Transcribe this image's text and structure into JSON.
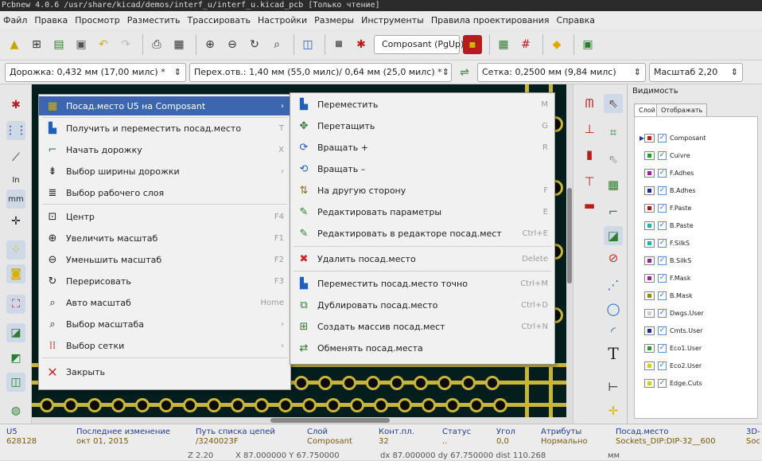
{
  "title_bar": "Pcbnew 4.0.6 /usr/share/kicad/demos/interf_u/interf_u.kicad_pcb [Только чтение]",
  "menubar": [
    "Файл",
    "Правка",
    "Просмотр",
    "Разместить",
    "Трассировать",
    "Настройки",
    "Размеры",
    "Инструменты",
    "Правила проектирования",
    "Справка"
  ],
  "toolbar": {
    "layer_select": "Composant (PgUp)",
    "track_width": "Дорожка: 0,432 мм (17,00 милс) *",
    "via_size": "Перех.отв.: 1,40 мм (55,0 милс)/ 0,64 мм (25,0 милс) *",
    "grid": "Сетка: 0,2500 мм (9,84 милс)",
    "zoom": "Масштаб 2,20"
  },
  "context_menu": {
    "header": "Посад.место U5 на Composant",
    "items": [
      {
        "label": "Получить и переместить посад.место",
        "shortcut": "T"
      },
      {
        "label": "Начать дорожку",
        "shortcut": "X"
      },
      {
        "label": "Выбор ширины дорожки",
        "shortcut": ""
      },
      {
        "label": "Выбор рабочего слоя",
        "shortcut": ""
      },
      {
        "label": "Центр",
        "shortcut": "F4"
      },
      {
        "label": "Увеличить масштаб",
        "shortcut": "F1"
      },
      {
        "label": "Уменьшить масштаб",
        "shortcut": "F2"
      },
      {
        "label": "Перерисовать",
        "shortcut": "F3"
      },
      {
        "label": "Авто масштаб",
        "shortcut": "Home"
      },
      {
        "label": "Выбор масштаба",
        "shortcut": ""
      },
      {
        "label": "Выбор сетки",
        "shortcut": ""
      },
      {
        "label": "Закрыть",
        "shortcut": ""
      }
    ]
  },
  "submenu": {
    "items": [
      {
        "label": "Переместить",
        "shortcut": "M"
      },
      {
        "label": "Перетащить",
        "shortcut": "G"
      },
      {
        "label": "Вращать +",
        "shortcut": "R"
      },
      {
        "label": "Вращать –",
        "shortcut": ""
      },
      {
        "label": "На другую сторону",
        "shortcut": "F"
      },
      {
        "label": "Редактировать параметры",
        "shortcut": "E"
      },
      {
        "label": "Редактировать в редакторе посад.мест",
        "shortcut": "Ctrl+E"
      },
      {
        "label": "Удалить посад.место",
        "shortcut": "Delete"
      },
      {
        "label": "Переместить посад.место точно",
        "shortcut": "Ctrl+M"
      },
      {
        "label": "Дублировать посад.место",
        "shortcut": "Ctrl+D"
      },
      {
        "label": "Создать массив посад.мест",
        "shortcut": "Ctrl+N"
      },
      {
        "label": "Обменять посад.места",
        "shortcut": ""
      }
    ]
  },
  "visibility": {
    "title": "Видимость",
    "tabs": [
      "Слой",
      "Отображать"
    ],
    "layers": [
      {
        "name": "Composant",
        "color": "#c21a1a"
      },
      {
        "name": "Cuivre",
        "color": "#2a9a2a"
      },
      {
        "name": "F.Adhes",
        "color": "#9a209a"
      },
      {
        "name": "B.Adhes",
        "color": "#1a2aa0"
      },
      {
        "name": "F.Paste",
        "color": "#a01a1a"
      },
      {
        "name": "B.Paste",
        "color": "#20b0b0"
      },
      {
        "name": "F.SilkS",
        "color": "#20b0b0"
      },
      {
        "name": "B.SilkS",
        "color": "#9a209a"
      },
      {
        "name": "F.Mask",
        "color": "#9a209a"
      },
      {
        "name": "B.Mask",
        "color": "#8a8a20"
      },
      {
        "name": "Dwgs.User",
        "color": "#cfcfcf"
      },
      {
        "name": "Cmts.User",
        "color": "#1a2aa0"
      },
      {
        "name": "Eco1.User",
        "color": "#2a9a2a"
      },
      {
        "name": "Eco2.User",
        "color": "#d0d020"
      },
      {
        "name": "Edge.Cuts",
        "color": "#d0d020"
      }
    ]
  },
  "status": {
    "ref": "U5",
    "ref_val": "628128",
    "lastmod_h": "Последнее изменение",
    "lastmod_v": "окт 01, 2015",
    "netpath_h": "Путь списка цепей",
    "netpath_v": "/3240023F",
    "layer_h": "Слой",
    "layer_v": "Composant",
    "pads_h": "Конт.пл.",
    "pads_v": "32",
    "status_h": "Статус",
    "status_v": "..",
    "angle_h": "Угол",
    "angle_v": "0,0",
    "attr_h": "Атрибуты",
    "attr_v": "Нормально",
    "footprint_h": "Посад.место",
    "footprint_v": "Sockets_DIP:DIP-32__600",
    "cut_h": "3D-",
    "cut_v": "Soc",
    "zoom": "Z 2.20",
    "coords": "X 87.000000  Y 67.750000",
    "delta": "dx 87.000000  dy 67.750000  dist 110.268",
    "units": "мм"
  }
}
